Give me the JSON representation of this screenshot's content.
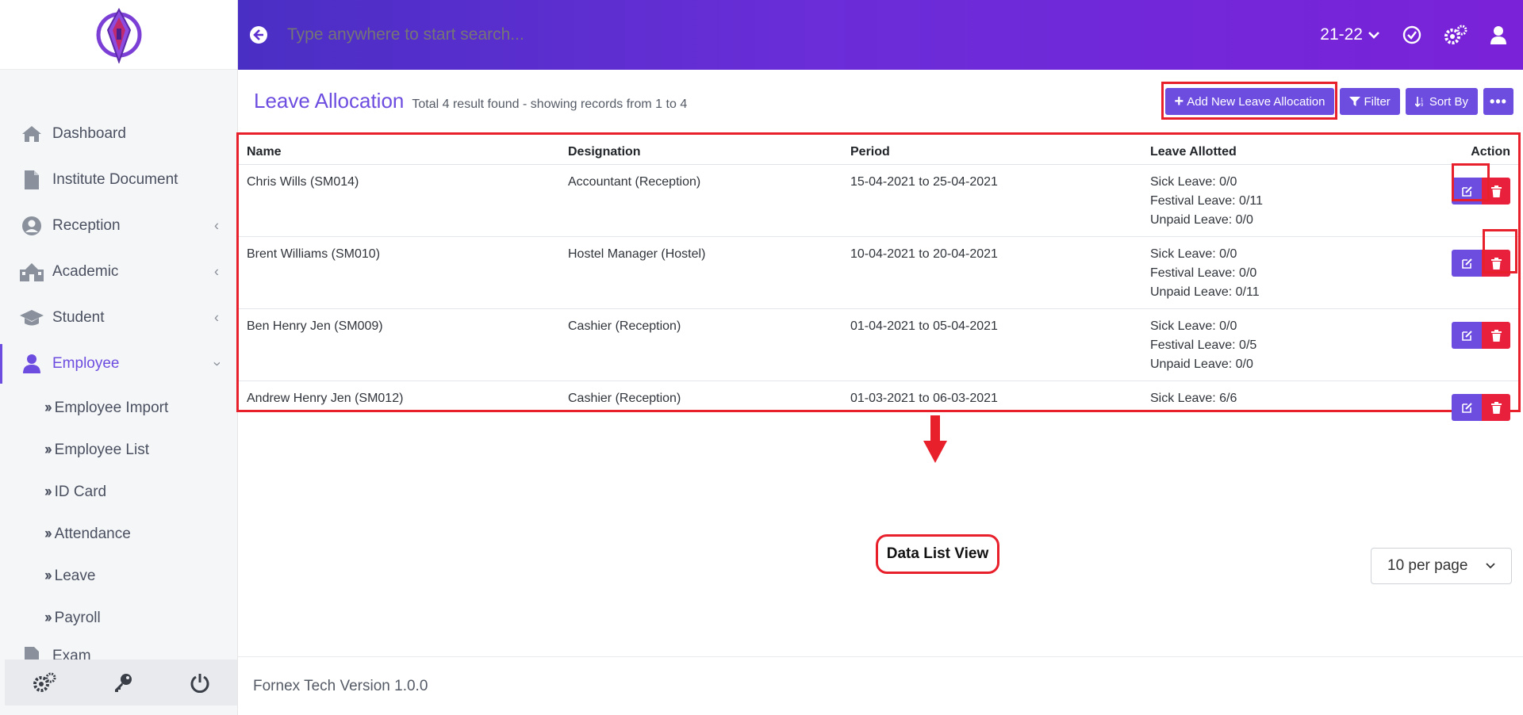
{
  "header": {
    "search_placeholder": "Type anywhere to start search...",
    "session_year": "21-22"
  },
  "sidebar": {
    "items": [
      {
        "label": "Dashboard"
      },
      {
        "label": "Institute Document"
      },
      {
        "label": "Reception"
      },
      {
        "label": "Academic"
      },
      {
        "label": "Student"
      },
      {
        "label": "Employee"
      }
    ],
    "employee_sub": [
      {
        "label": "Employee Import"
      },
      {
        "label": "Employee List"
      },
      {
        "label": "ID Card"
      },
      {
        "label": "Attendance"
      },
      {
        "label": "Leave"
      },
      {
        "label": "Payroll"
      }
    ],
    "partial_item": "Exam"
  },
  "page": {
    "title": "Leave Allocation",
    "subtitle": "Total 4 result found - showing records from 1 to 4"
  },
  "toolbar": {
    "add_label": "Add New Leave Allocation",
    "filter_label": "Filter",
    "sort_label": "Sort By"
  },
  "table": {
    "headers": {
      "name": "Name",
      "designation": "Designation",
      "period": "Period",
      "leave": "Leave Allotted",
      "action": "Action"
    },
    "rows": [
      {
        "name": "Chris Wills (SM014)",
        "designation": "Accountant (Reception)",
        "period": "15-04-2021 to 25-04-2021",
        "leaves": [
          "Sick Leave: 0/0",
          "Festival Leave: 0/11",
          "Unpaid Leave: 0/0"
        ]
      },
      {
        "name": "Brent Williams (SM010)",
        "designation": "Hostel Manager (Hostel)",
        "period": "10-04-2021 to 20-04-2021",
        "leaves": [
          "Sick Leave: 0/0",
          "Festival Leave: 0/0",
          "Unpaid Leave: 0/11"
        ]
      },
      {
        "name": "Ben Henry Jen (SM009)",
        "designation": "Cashier (Reception)",
        "period": "01-04-2021 to 05-04-2021",
        "leaves": [
          "Sick Leave: 0/0",
          "Festival Leave: 0/5",
          "Unpaid Leave: 0/0"
        ]
      },
      {
        "name": "Andrew Henry Jen (SM012)",
        "designation": "Cashier (Reception)",
        "period": "01-03-2021 to 06-03-2021",
        "leaves": [
          "Sick Leave: 6/6"
        ]
      }
    ]
  },
  "annotation": {
    "label": "Data List View"
  },
  "pagination": {
    "per_page": "10 per page"
  },
  "footer": {
    "text": "Fornex Tech Version 1.0.0"
  },
  "colors": {
    "accent": "#6d4de0",
    "danger": "#e8203c",
    "highlight": "#e8202c"
  }
}
